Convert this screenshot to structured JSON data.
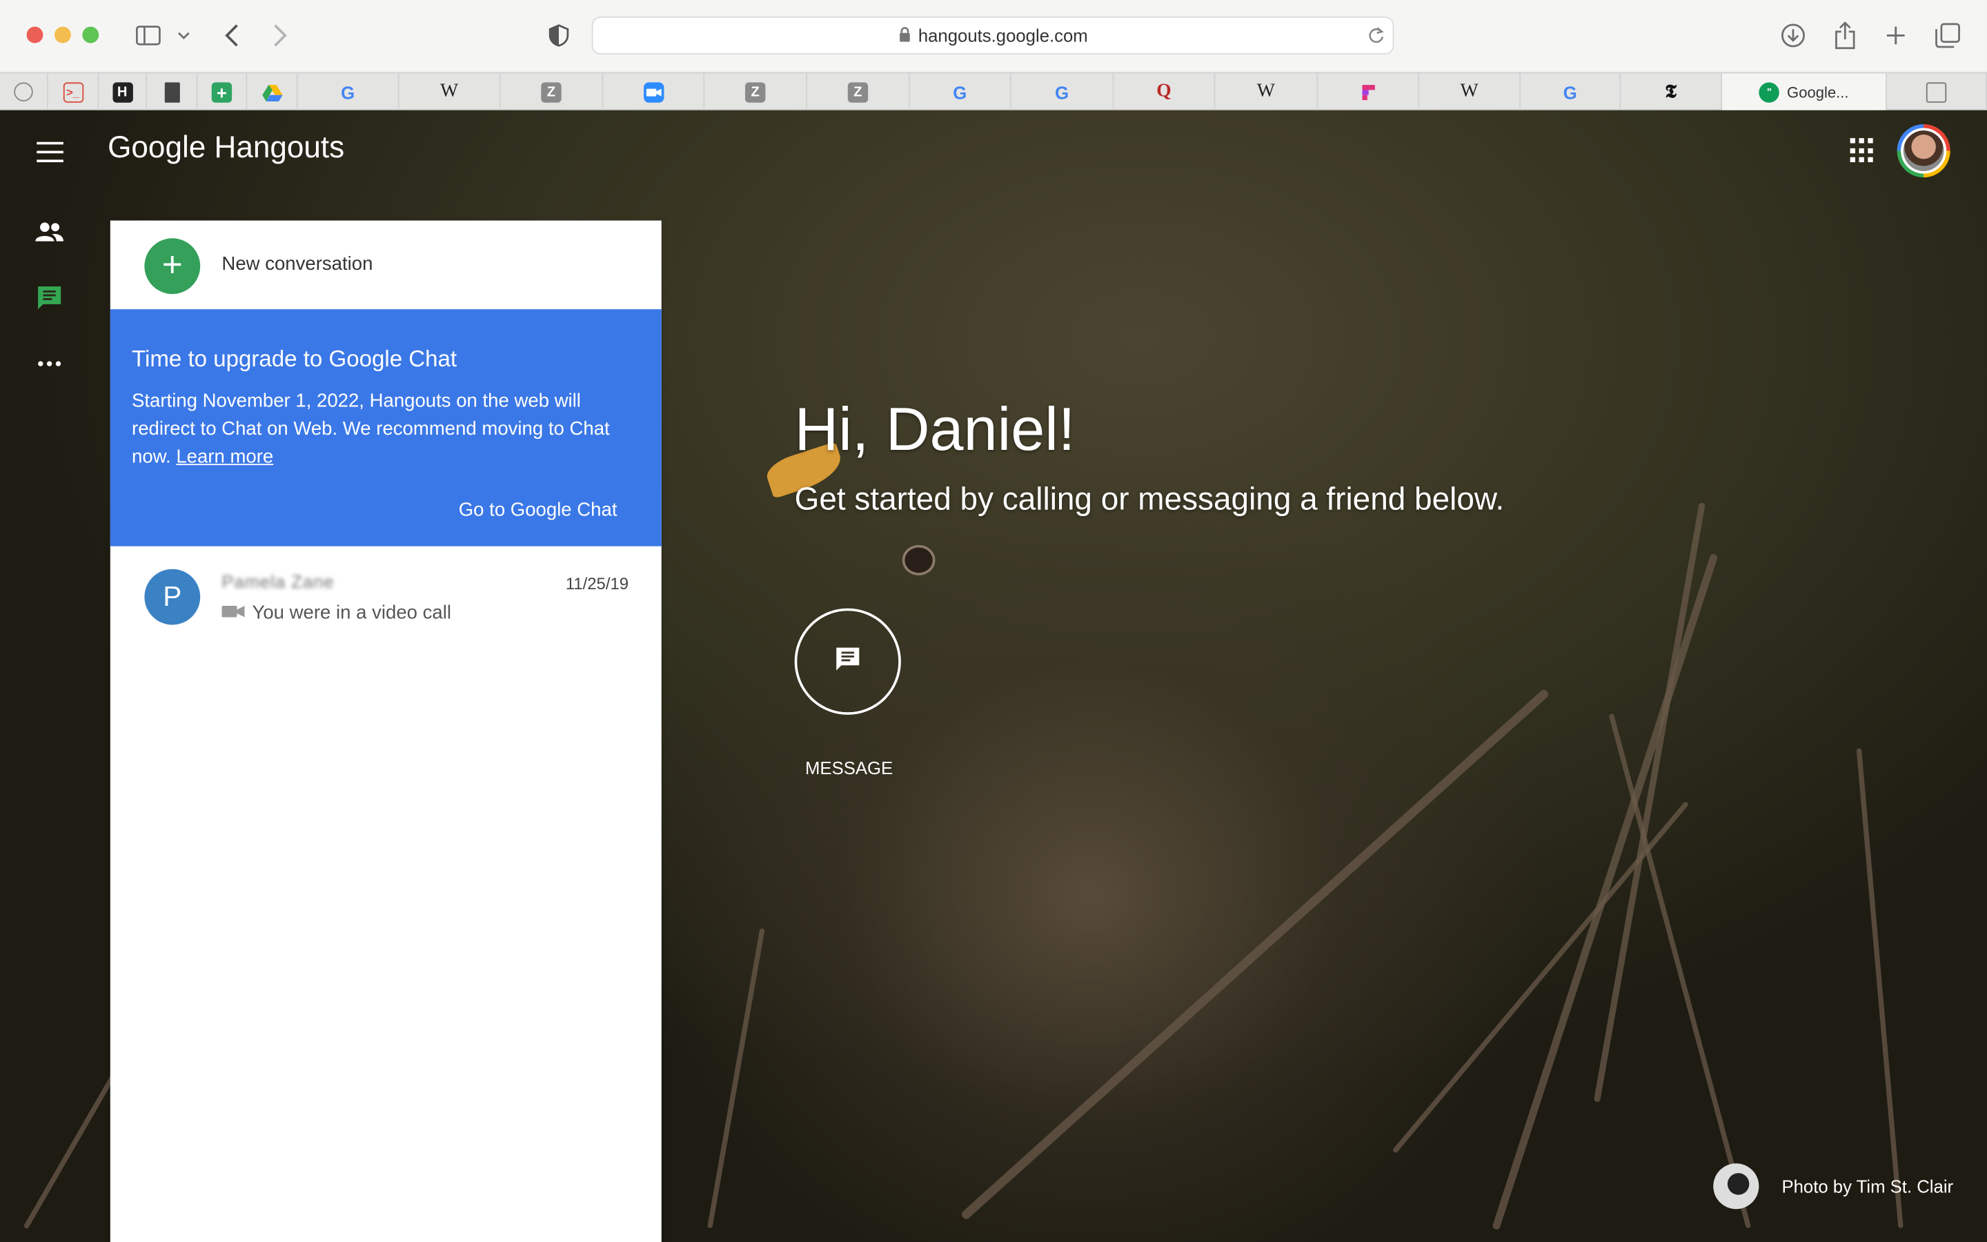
{
  "browser": {
    "url": "hangouts.google.com",
    "active_tab_title": "Google...",
    "tab_favicons": [
      "speech-bubble-icon",
      "terminal-icon",
      "hackernews-h-icon",
      "docs-icon",
      "sheets-icon",
      "drive-icon",
      "google-g-icon",
      "wikipedia-w-icon",
      "zotero-z-icon",
      "zoom-icon",
      "zotero-z-icon",
      "zotero-z-icon",
      "google-g-icon",
      "google-g-icon",
      "quora-q-icon",
      "wikipedia-w-icon",
      "figma-icon",
      "wikipedia-w-icon",
      "google-g-icon",
      "nytimes-t-icon",
      "hangouts-icon",
      "blank-tab-icon"
    ],
    "tab_glyphs": {
      "h": "H",
      "w": "W",
      "z": "Z",
      "g": "G",
      "q": "Q",
      "t": "𝕿"
    }
  },
  "app": {
    "logo_google": "Google",
    "logo_product": "Hangouts"
  },
  "panel": {
    "new_conversation": "New conversation",
    "banner": {
      "title": "Time to upgrade to Google Chat",
      "body": "Starting November 1, 2022, Hangouts on the web will redirect to Chat on Web. We recommend moving to Chat now.",
      "learn_more": "Learn more",
      "cta": "Go to Google Chat"
    },
    "conversations": [
      {
        "initial": "P",
        "name": "Pamela Zane",
        "date": "11/25/19",
        "preview": "You were in a video call"
      }
    ]
  },
  "greeting": {
    "title": "Hi, Daniel!",
    "subtitle": "Get started by calling or messaging a friend below.",
    "message_label": "MESSAGE"
  },
  "credit": "Photo by Tim St. Clair",
  "colors": {
    "accent_blue": "#3b78e7",
    "new_conv_green": "#34a05a",
    "avatar_blue": "#3b82c4",
    "chat_icon_green": "#34a853"
  }
}
